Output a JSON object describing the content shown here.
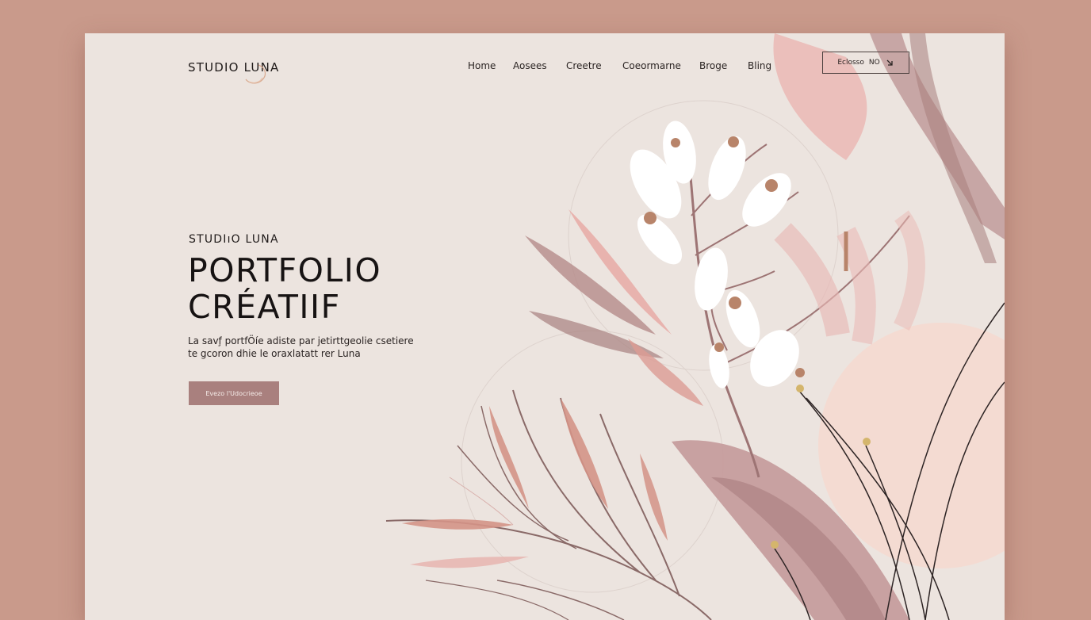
{
  "header": {
    "logo": "STUDIO LUNA",
    "nav": [
      "Home",
      "Aosees",
      "Creetre",
      "Coeormarne",
      "Broge",
      "Bling"
    ],
    "cta_label": "Eclosso",
    "cta_suffix": "NO"
  },
  "hero": {
    "eyebrow": "STUDIıO LUNA",
    "title_line1": "PORTFOLIO",
    "title_line2": "CRÉATIIF",
    "desc_line1": "La savf̧ portfÖíe adiste par jetirttgeolie csetiere",
    "desc_line2": "te gcoron dhie le oraxlatatt rer Luna",
    "button_label": "Evezo l'Udocrieoe"
  },
  "colors": {
    "backdrop": "#c99a8b",
    "page": "#ece4df",
    "accent": "#a9807e",
    "text": "#1f1a19"
  }
}
